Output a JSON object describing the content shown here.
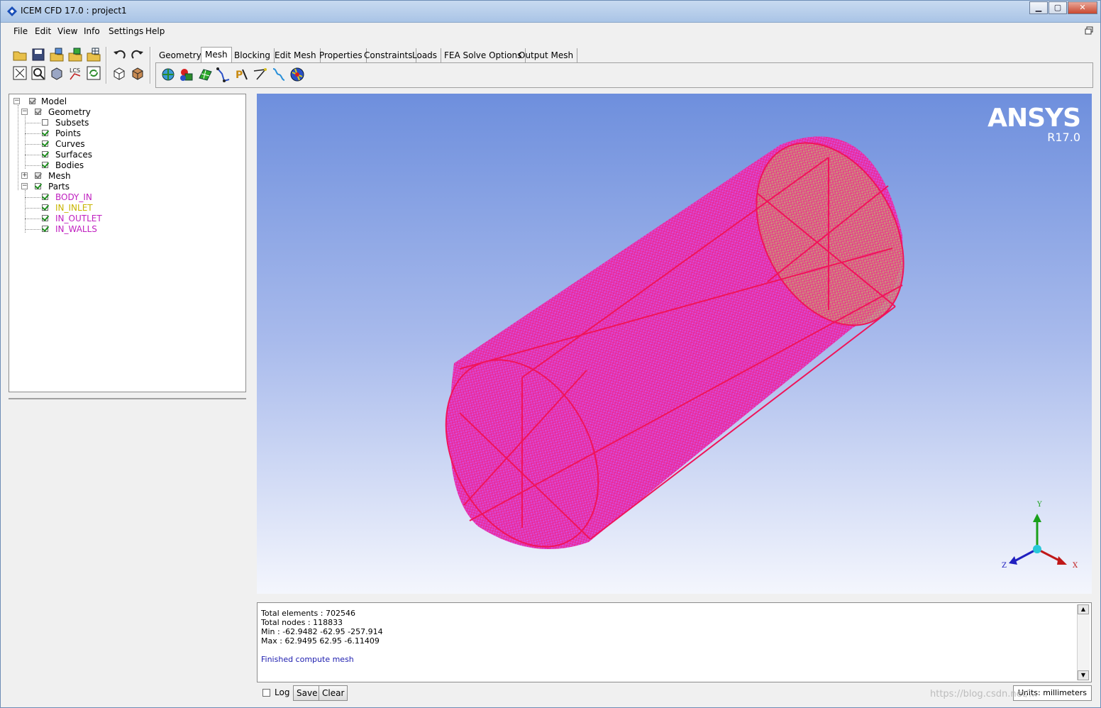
{
  "window": {
    "title": "ICEM CFD 17.0 : project1"
  },
  "menu": [
    "File",
    "Edit",
    "View",
    "Info",
    "Settings",
    "Help"
  ],
  "tabs": [
    "Geometry",
    "Mesh",
    "Blocking",
    "Edit Mesh",
    "Properties",
    "Constraints",
    "Loads",
    "FEA Solve Options",
    "Output Mesh"
  ],
  "active_tab": "Mesh",
  "tree": {
    "model": "Model",
    "geometry": "Geometry",
    "subsets": "Subsets",
    "points": "Points",
    "curves": "Curves",
    "surfaces": "Surfaces",
    "bodies": "Bodies",
    "mesh": "Mesh",
    "parts": "Parts",
    "part_items": [
      {
        "label": "BODY_IN",
        "color": "#c020c0"
      },
      {
        "label": "IN_INLET",
        "color": "#c8b400"
      },
      {
        "label": "IN_OUTLET",
        "color": "#c020c0"
      },
      {
        "label": "IN_WALLS",
        "color": "#c020c0"
      }
    ]
  },
  "viewport": {
    "logo": "ANSYS",
    "version": "R17.0",
    "mesh_color": "#f0228a",
    "axes": {
      "x": "X",
      "y": "Y",
      "z": "Z"
    }
  },
  "console": {
    "lines": [
      "Total elements : 702546",
      "Total nodes : 118833",
      "Min : -62.9482 -62.95 -257.914",
      "Max : 62.9495 62.95 -6.11409"
    ],
    "status": "Finished compute mesh"
  },
  "bottom": {
    "log_label": "Log",
    "save_label": "Save",
    "clear_label": "Clear",
    "units": "Units: millimeters"
  },
  "watermark": "https://blog.csdn.net/..."
}
